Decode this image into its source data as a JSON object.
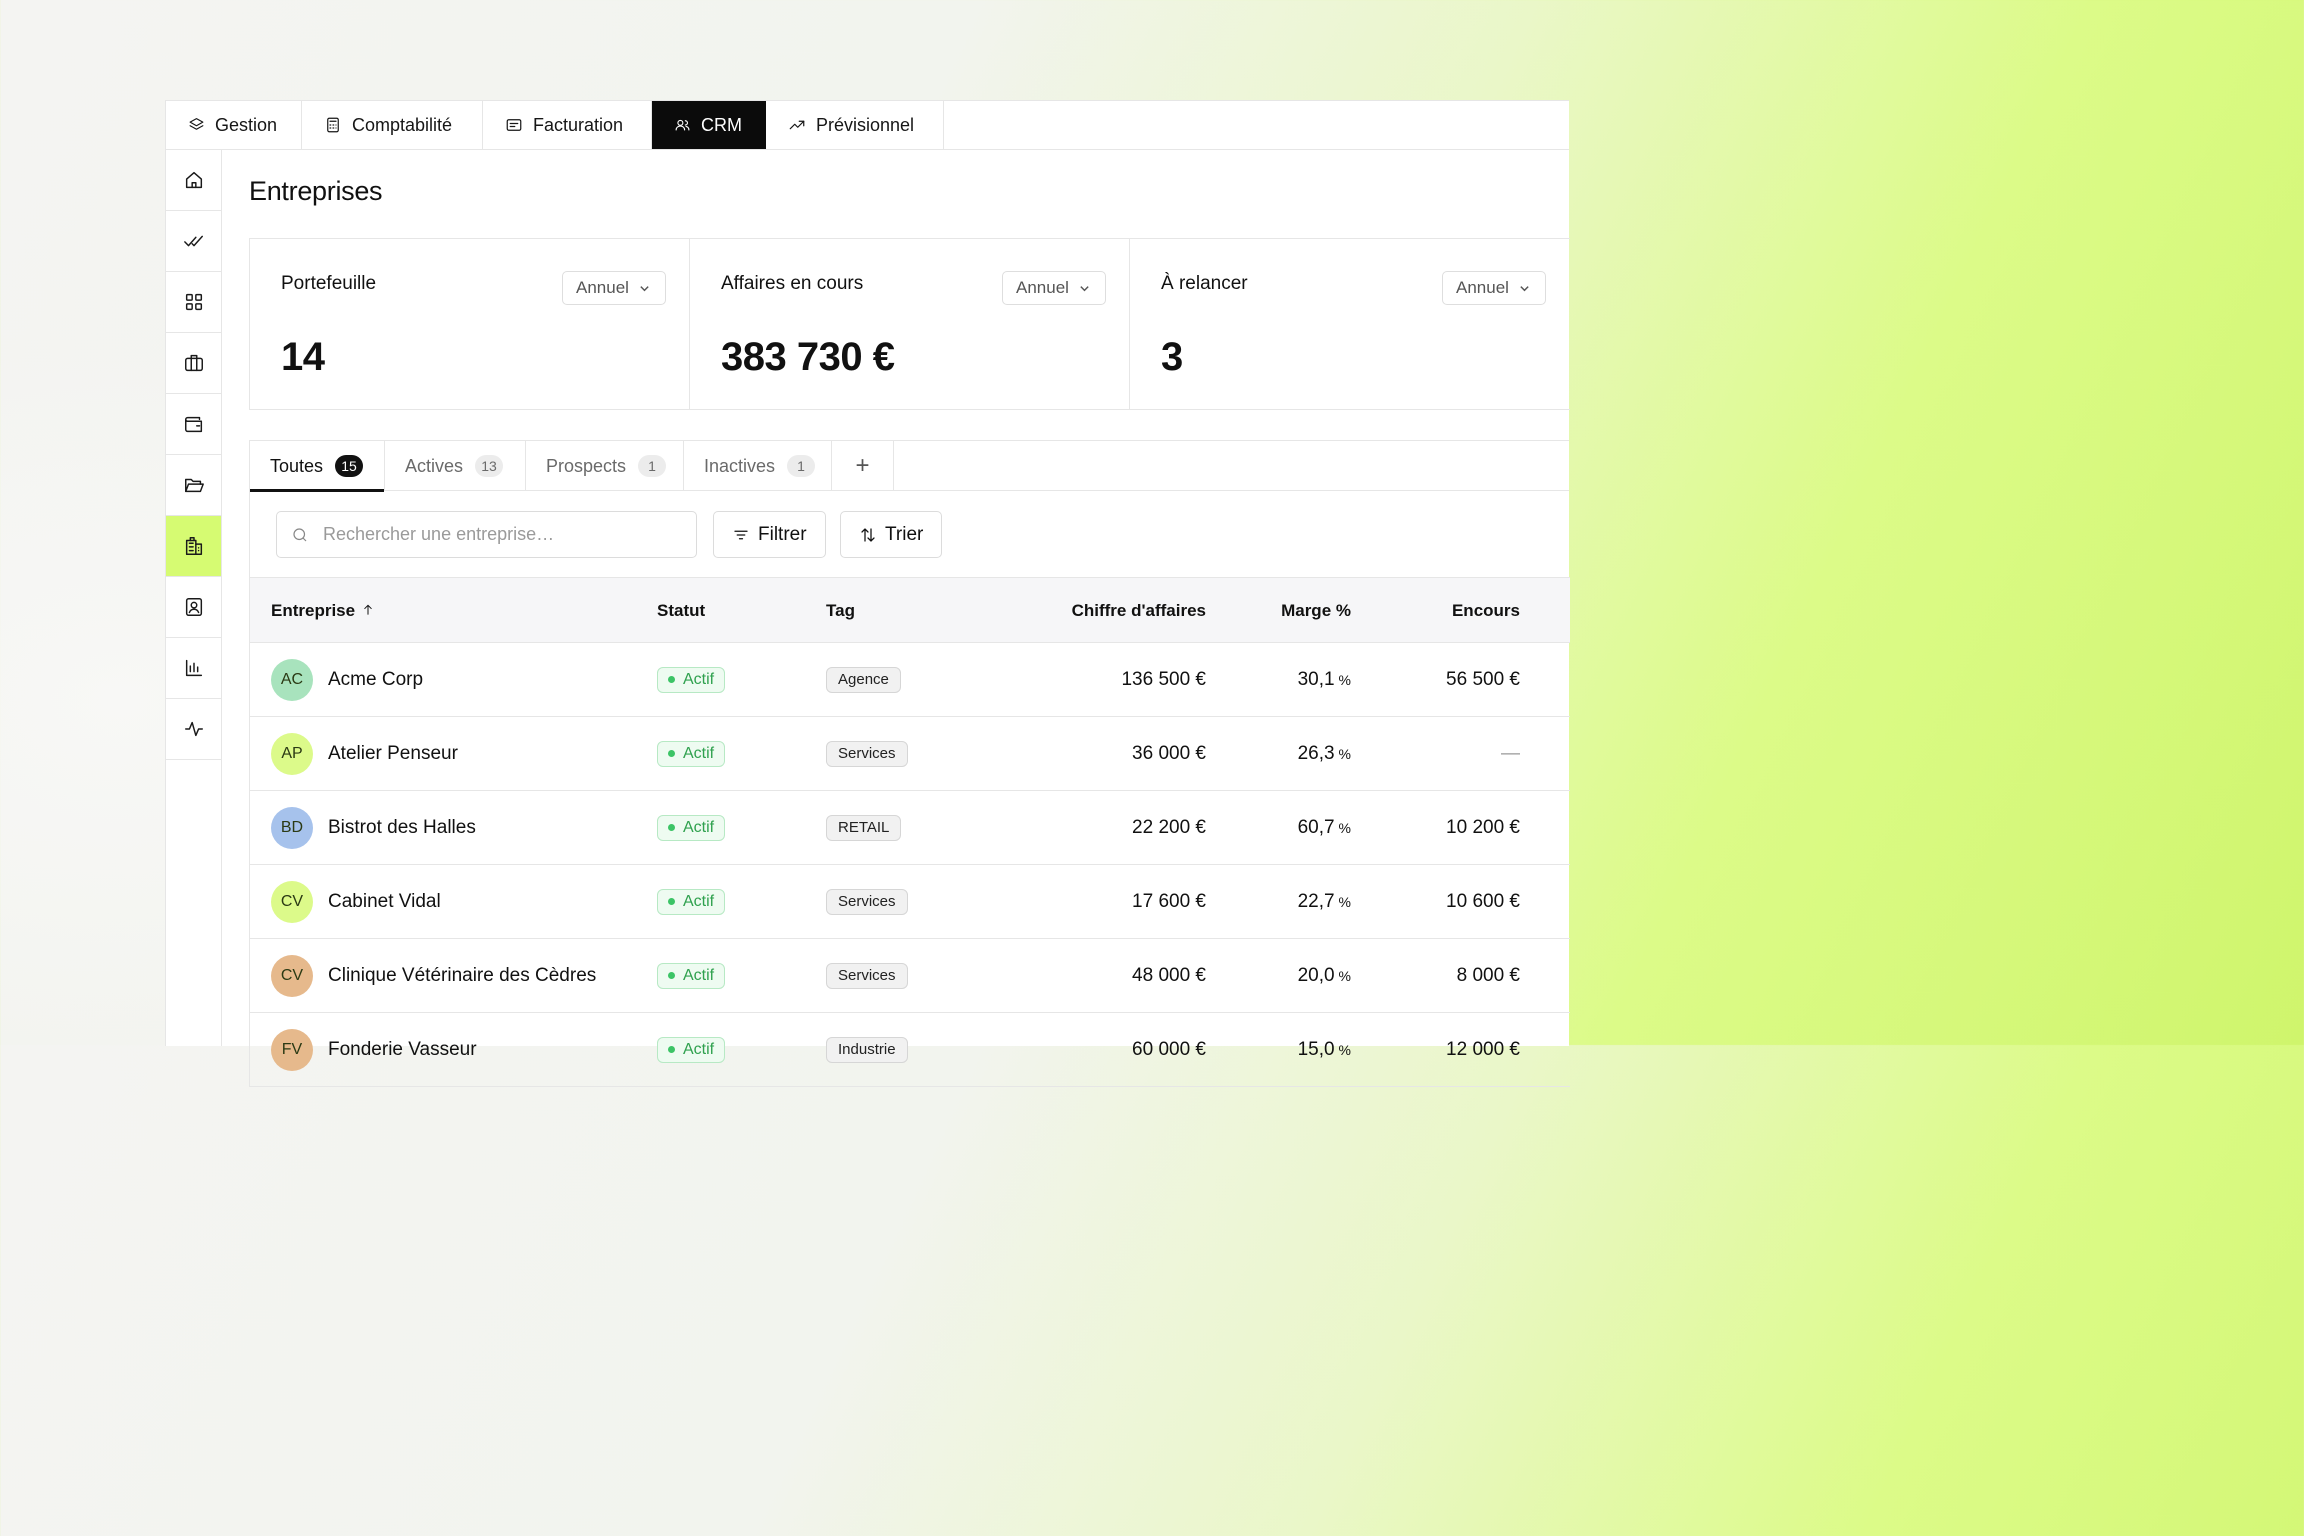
{
  "topnav": [
    {
      "label": "Gestion",
      "icon": "layers-icon",
      "active": false,
      "width": 136
    },
    {
      "label": "Comptabilité",
      "icon": "calculator-icon",
      "active": false,
      "width": 181
    },
    {
      "label": "Facturation",
      "icon": "receipt-icon",
      "active": false,
      "width": 169
    },
    {
      "label": "CRM",
      "icon": "users-icon",
      "active": true,
      "width": 114
    },
    {
      "label": "Prévisionnel",
      "icon": "trend-up-icon",
      "active": false,
      "width": 178
    }
  ],
  "sidebar": [
    {
      "name": "home",
      "icon": "home-icon"
    },
    {
      "name": "tasks",
      "icon": "double-check-icon"
    },
    {
      "name": "apps",
      "icon": "grid-icon"
    },
    {
      "name": "portfolio",
      "icon": "briefcase-icon"
    },
    {
      "name": "wallet",
      "icon": "wallet-icon"
    },
    {
      "name": "folders",
      "icon": "folder-open-icon"
    },
    {
      "name": "companies",
      "icon": "building-icon",
      "active": true
    },
    {
      "name": "contacts",
      "icon": "contact-card-icon"
    },
    {
      "name": "reports",
      "icon": "bar-chart-icon"
    },
    {
      "name": "activity",
      "icon": "pulse-icon"
    }
  ],
  "page": {
    "title": "Entreprises"
  },
  "kpis": [
    {
      "label": "Portefeuille",
      "period": "Annuel",
      "value": "14"
    },
    {
      "label": "Affaires en cours",
      "period": "Annuel",
      "value": "383 730 €"
    },
    {
      "label": "À relancer",
      "period": "Annuel",
      "value": "3"
    }
  ],
  "segments": [
    {
      "label": "Toutes",
      "count": "15",
      "active": true
    },
    {
      "label": "Actives",
      "count": "13"
    },
    {
      "label": "Prospects",
      "count": "1"
    },
    {
      "label": "Inactives",
      "count": "1"
    }
  ],
  "segments_add": "+",
  "search": {
    "placeholder": "Rechercher une entreprise…"
  },
  "toolbar": {
    "filter_label": "Filtrer",
    "sort_label": "Trier"
  },
  "table": {
    "headers": {
      "company": "Entreprise",
      "status": "Statut",
      "tag": "Tag",
      "revenue": "Chiffre d'affaires",
      "margin": "Marge %",
      "outstanding": "Encours"
    },
    "rows": [
      {
        "initials": "AC",
        "avatar_color": "#a8e3bd",
        "company": "Acme Corp",
        "status": "Actif",
        "tag": "Agence",
        "revenue": "136 500 €",
        "margin": "30,1",
        "outstanding": "56 500 €"
      },
      {
        "initials": "AP",
        "avatar_color": "#dcfa8a",
        "company": "Atelier Penseur",
        "status": "Actif",
        "tag": "Services",
        "revenue": "36 000 €",
        "margin": "26,3",
        "outstanding": "—"
      },
      {
        "initials": "BD",
        "avatar_color": "#a6c2ec",
        "company": "Bistrot des Halles",
        "status": "Actif",
        "tag": "RETAIL",
        "revenue": "22 200 €",
        "margin": "60,7",
        "outstanding": "10 200 €"
      },
      {
        "initials": "CV",
        "avatar_color": "#dcfa8a",
        "company": "Cabinet Vidal",
        "status": "Actif",
        "tag": "Services",
        "revenue": "17 600 €",
        "margin": "22,7",
        "outstanding": "10 600 €"
      },
      {
        "initials": "CV",
        "avatar_color": "#e6b98c",
        "company": "Clinique Vétérinaire des Cèdres",
        "status": "Actif",
        "tag": "Services",
        "revenue": "48 000 €",
        "margin": "20,0",
        "outstanding": "8 000 €"
      },
      {
        "initials": "FV",
        "avatar_color": "#e6b98c",
        "company": "Fonderie Vasseur",
        "status": "Actif",
        "tag": "Industrie",
        "revenue": "60 000 €",
        "margin": "15,0",
        "outstanding": "12 000 €"
      }
    ],
    "percent_symbol": "%"
  }
}
